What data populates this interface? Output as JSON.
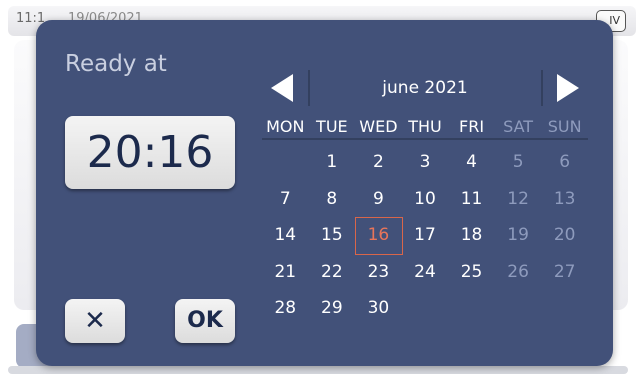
{
  "background": {
    "time": "11:1",
    "date": "19/06/2021",
    "badge": "IV"
  },
  "dialog": {
    "ready_label": "Ready at",
    "time_value": "20:16",
    "cancel_label": "✕",
    "ok_label": "OK"
  },
  "calendar": {
    "month_label": "june 2021",
    "prev_icon": "triangle-left",
    "next_icon": "triangle-right",
    "weekdays": [
      "MON",
      "TUE",
      "WED",
      "THU",
      "FRI",
      "SAT",
      "SUN"
    ],
    "first_weekday_index": 1,
    "days_in_month": 30,
    "selected_day": 16,
    "days": [
      "1",
      "2",
      "3",
      "4",
      "5",
      "6",
      "7",
      "8",
      "9",
      "10",
      "11",
      "12",
      "13",
      "14",
      "15",
      "16",
      "17",
      "18",
      "19",
      "20",
      "21",
      "22",
      "23",
      "24",
      "25",
      "26",
      "27",
      "28",
      "29",
      "30"
    ]
  },
  "colors": {
    "dialog_bg": "#425179",
    "weekend_text": "#8e9bbd",
    "selected_text": "#e8755a",
    "selected_border": "#d9664a"
  }
}
